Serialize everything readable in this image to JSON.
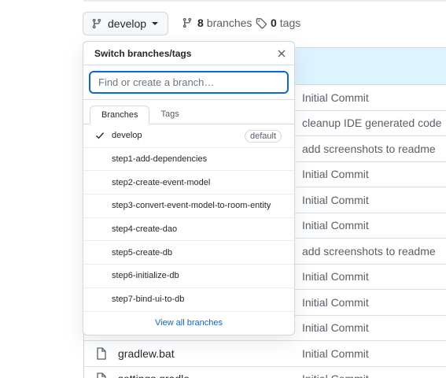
{
  "branch_button": {
    "label": "develop",
    "icon": "git-branch-icon"
  },
  "meta": {
    "branches_count": "8",
    "branches_label": "branches",
    "tags_count": "0",
    "tags_label": "tags"
  },
  "dropdown": {
    "title": "Switch branches/tags",
    "filter_placeholder": "Find or create a branch…",
    "filter_value": "",
    "tabs": [
      "Branches",
      "Tags"
    ],
    "items": [
      {
        "label": "develop",
        "selected": true,
        "badge": "default"
      },
      {
        "label": "step1-add-dependencies"
      },
      {
        "label": "step2-create-event-model"
      },
      {
        "label": "step3-convert-event-model-to-room-entity"
      },
      {
        "label": "step4-create-dao"
      },
      {
        "label": "step5-create-db"
      },
      {
        "label": "step6-initialize-db"
      },
      {
        "label": "step7-bind-ui-to-db"
      }
    ],
    "footer": "View all branches"
  },
  "files": [
    {
      "name": "",
      "message": "Initial Commit"
    },
    {
      "name": "",
      "message": "cleanup IDE generated code"
    },
    {
      "name": "",
      "message": "add screenshots to readme"
    },
    {
      "name": "",
      "message": "Initial Commit"
    },
    {
      "name": "",
      "message": "Initial Commit"
    },
    {
      "name": "",
      "message": "Initial Commit"
    },
    {
      "name": "",
      "message": "add screenshots to readme"
    },
    {
      "name": "",
      "message": "Initial Commit"
    },
    {
      "name": "",
      "message": "Initial Commit"
    },
    {
      "name": "",
      "message": "Initial Commit"
    },
    {
      "name": "gradlew.bat",
      "message": "Initial Commit"
    },
    {
      "name": "settings.gradle",
      "message": "Initial Commit"
    }
  ],
  "colors": {
    "accent": "#0969da",
    "header_bg": "#ddf4ff",
    "border": "#d0d7de"
  }
}
